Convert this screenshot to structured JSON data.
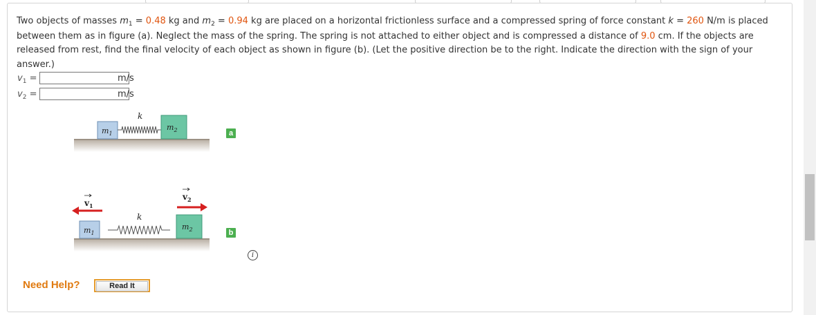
{
  "question": {
    "t1": "Two objects of masses ",
    "m1_sym": "m",
    "m1_sub": "1",
    "eq1": " = ",
    "m1_val": "0.48",
    "t2": " kg and ",
    "m2_sym": "m",
    "m2_sub": "2",
    "eq2": " = ",
    "m2_val": "0.94",
    "t3": " kg are placed on a horizontal frictionless surface and a compressed spring of force constant ",
    "k_sym": "k",
    "eq3": " = ",
    "k_val": "260",
    "t4": " N/m is placed between them as in figure (a). Neglect the mass of the spring. The spring is not attached to either object and is compressed a distance of ",
    "d_val": "9.0",
    "t5": " cm. If the objects are released from rest, find the final velocity of each object as shown in figure (b). (Let the positive direction be to the right. Indicate the direction with the sign of your answer.)"
  },
  "answers": [
    {
      "label_sym": "v",
      "label_sub": "1",
      "label_eq": " =",
      "value": "",
      "unit": "m/s"
    },
    {
      "label_sym": "v",
      "label_sub": "2",
      "label_eq": " =",
      "value": "",
      "unit": "m/s"
    }
  ],
  "figure": {
    "a": {
      "m1": "m",
      "m1_sub": "1",
      "k": "k",
      "m2": "m",
      "m2_sub": "2",
      "badge": "a"
    },
    "b": {
      "v1": "v",
      "v1_sub": "1",
      "v2": "v",
      "v2_sub": "2",
      "m1": "m",
      "m1_sub": "1",
      "k": "k",
      "m2": "m",
      "m2_sub": "2",
      "badge": "b"
    },
    "info": "i"
  },
  "help": {
    "need_help": "Need Help?",
    "read_it": "Read It"
  },
  "colors": {
    "value": "#e0540e",
    "block_m1": "#b7cfe8",
    "block_m2": "#6cc6a4",
    "arrow": "#d62020",
    "badge": "#4caf50",
    "floor": "#c9c0b4"
  }
}
